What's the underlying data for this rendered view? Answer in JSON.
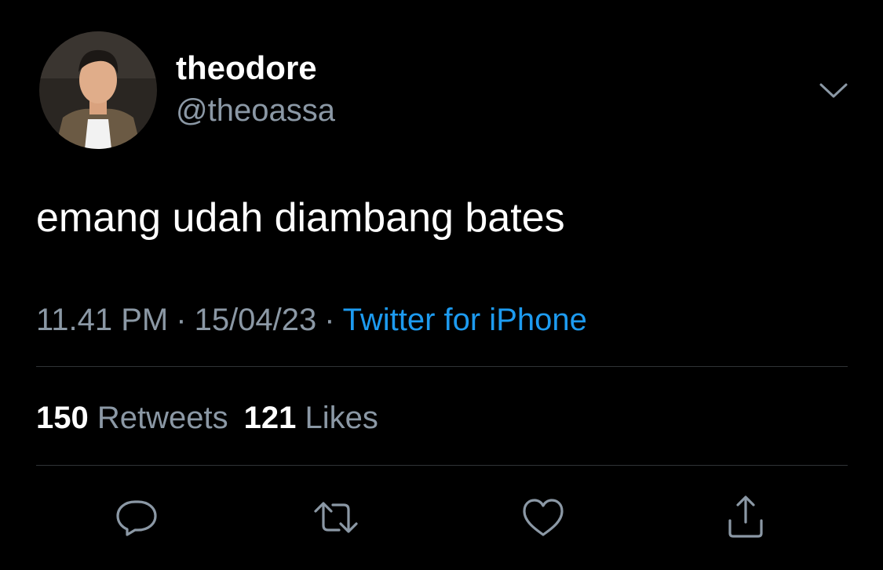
{
  "user": {
    "display_name": "theodore",
    "handle": "@theoassa"
  },
  "tweet": {
    "text": "emang udah diambang bates",
    "time": "11.41 PM",
    "date": "15/04/23",
    "separator": "·",
    "source": "Twitter for iPhone"
  },
  "stats": {
    "retweets_count": "150",
    "retweets_label": "Retweets",
    "likes_count": "121",
    "likes_label": "Likes"
  },
  "actions": [
    {
      "name": "reply",
      "icon": "speech-bubble-icon"
    },
    {
      "name": "retweet",
      "icon": "retweet-arrows-icon"
    },
    {
      "name": "like",
      "icon": "heart-icon"
    },
    {
      "name": "share",
      "icon": "share-upload-icon"
    }
  ],
  "colors": {
    "background": "#000000",
    "text_primary": "#ffffff",
    "text_secondary": "#8b98a5",
    "link": "#1d9bf0",
    "divider": "#2f3336"
  }
}
